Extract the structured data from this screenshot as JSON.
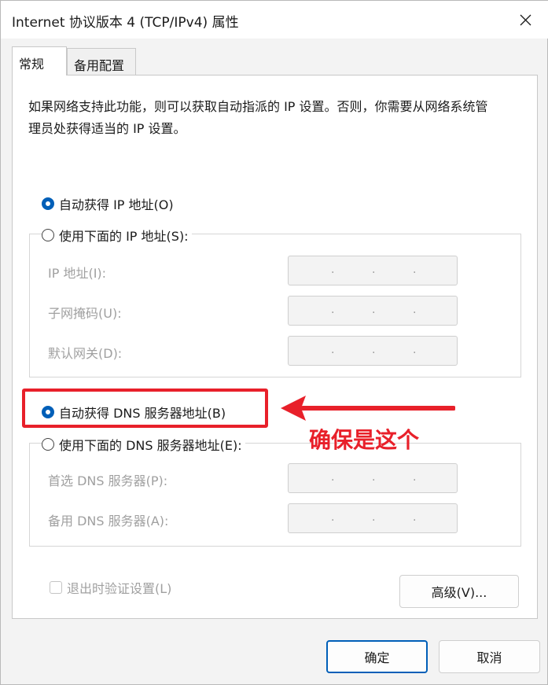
{
  "window": {
    "title": "Internet 协议版本 4 (TCP/IPv4) 属性",
    "close_icon": "close-icon"
  },
  "tabs": [
    {
      "label": "常规",
      "selected": true
    },
    {
      "label": "备用配置",
      "selected": false
    }
  ],
  "general": {
    "description": "如果网络支持此功能，则可以获取自动指派的 IP 设置。否则，你需要从网络系统管理员处获得适当的 IP 设置。",
    "ip": {
      "auto_label": "自动获得 IP 地址(O)",
      "auto_selected": true,
      "manual_label": "使用下面的 IP 地址(S):",
      "manual_selected": false,
      "fields": [
        {
          "label": "IP 地址(I):",
          "value": ". . ."
        },
        {
          "label": "子网掩码(U):",
          "value": ". . ."
        },
        {
          "label": "默认网关(D):",
          "value": ". . ."
        }
      ]
    },
    "dns": {
      "auto_label": "自动获得 DNS 服务器地址(B)",
      "auto_selected": true,
      "manual_label": "使用下面的 DNS 服务器地址(E):",
      "manual_selected": false,
      "fields": [
        {
          "label": "首选 DNS 服务器(P):",
          "value": ". . ."
        },
        {
          "label": "备用 DNS 服务器(A):",
          "value": ". . ."
        }
      ]
    },
    "validate_label": "退出时验证设置(L)",
    "validate_checked": false,
    "advanced_label": "高级(V)..."
  },
  "annotation": {
    "text": "确保是这个",
    "color": "#e8202a"
  },
  "footer": {
    "ok_label": "确定",
    "cancel_label": "取消"
  },
  "colors": {
    "accent": "#005fb8",
    "annotation_red": "#e8202a"
  }
}
